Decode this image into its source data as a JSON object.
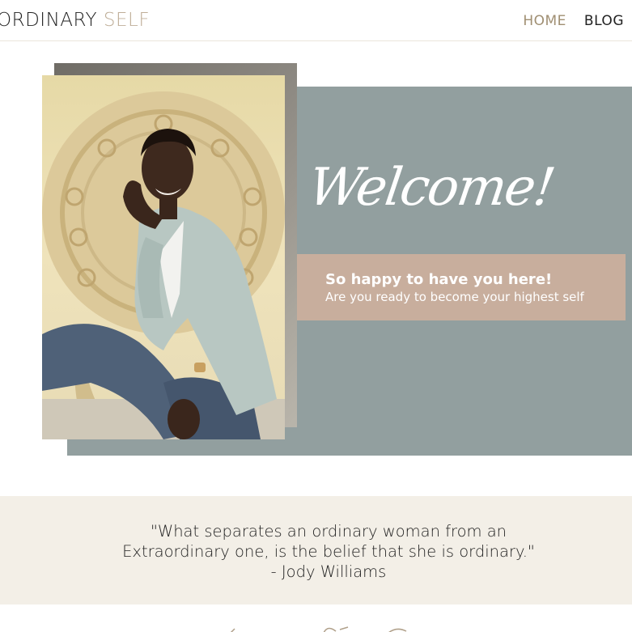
{
  "header": {
    "logo_main": "ORDINARY",
    "logo_accent": "SELF",
    "nav": [
      {
        "label": "HOME",
        "active": true
      },
      {
        "label": "BLOG",
        "active": false
      }
    ]
  },
  "hero": {
    "welcome": "Welcome!",
    "tagline_title": "So happy to have you here!",
    "tagline_sub": "Are you ready to become your highest self"
  },
  "quote": {
    "line1": "\"What separates an ordinary woman from an",
    "line2": "Extraordinary one, is the belief that she is ordinary.\"",
    "author": "- Jody Williams"
  },
  "colors": {
    "accent_tan": "#bfae98",
    "panel_grey": "#929f9f",
    "band_tan": "#c8ae9d",
    "quote_bg": "#f3efe7"
  }
}
